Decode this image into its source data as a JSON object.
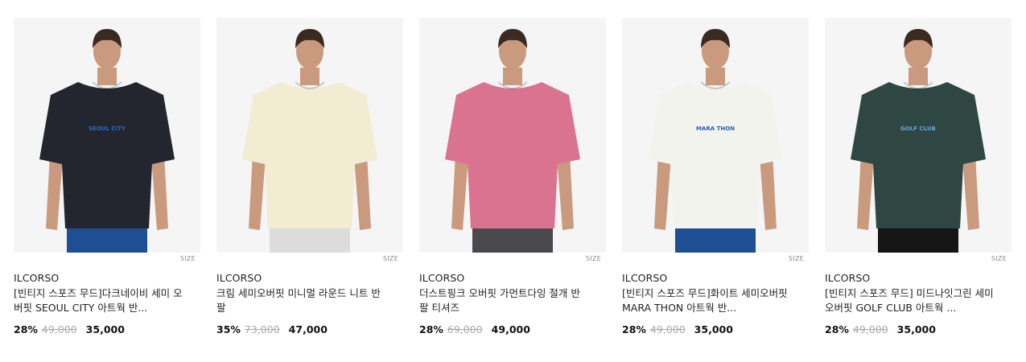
{
  "products": [
    {
      "brand": "ILCORSO",
      "title": "[빈티지 스포즈 무드]다크네이비 세미 오버핏 SEOUL CITY 아트웍 반...",
      "discount": "28%",
      "original_price": "49,000",
      "sale_price": "35,000",
      "size_badge": "SIZE",
      "shirt_color": "#23252f",
      "pants_color": "#1e4f92",
      "print_text": "SEOUL CITY",
      "print_color": "#2a6acb"
    },
    {
      "brand": "ILCORSO",
      "title": "크림 세미오버핏 미니멀 라운드 니트 반팔",
      "discount": "35%",
      "original_price": "73,000",
      "sale_price": "47,000",
      "size_badge": "SIZE",
      "shirt_color": "#f1ecd2",
      "pants_color": "#dcdcdc",
      "print_text": "",
      "print_color": "#f1ecd2"
    },
    {
      "brand": "ILCORSO",
      "title": "더스트핑크 오버핏 가먼트다잉 절개 반팔 티셔즈",
      "discount": "28%",
      "original_price": "69,000",
      "sale_price": "49,000",
      "size_badge": "SIZE",
      "shirt_color": "#d9738f",
      "pants_color": "#4a4a4e",
      "print_text": "",
      "print_color": "#d9738f"
    },
    {
      "brand": "ILCORSO",
      "title": "[빈티지 스포즈 무드]화이트 세미오버핏 MARA THON 아트웍 반...",
      "discount": "28%",
      "original_price": "49,000",
      "sale_price": "35,000",
      "size_badge": "SIZE",
      "shirt_color": "#f3f3ee",
      "pants_color": "#1e4f92",
      "print_text": "MARA THON",
      "print_color": "#2a5fb8"
    },
    {
      "brand": "ILCORSO",
      "title": "[빈티지 스포즈 무드] 미드나잇그린 세미 오버핏 GOLF CLUB 아트웍 ...",
      "discount": "28%",
      "original_price": "49,000",
      "sale_price": "35,000",
      "size_badge": "SIZE",
      "shirt_color": "#2f4742",
      "pants_color": "#151515",
      "print_text": "GOLF CLUB",
      "print_color": "#6aa2d6"
    }
  ]
}
